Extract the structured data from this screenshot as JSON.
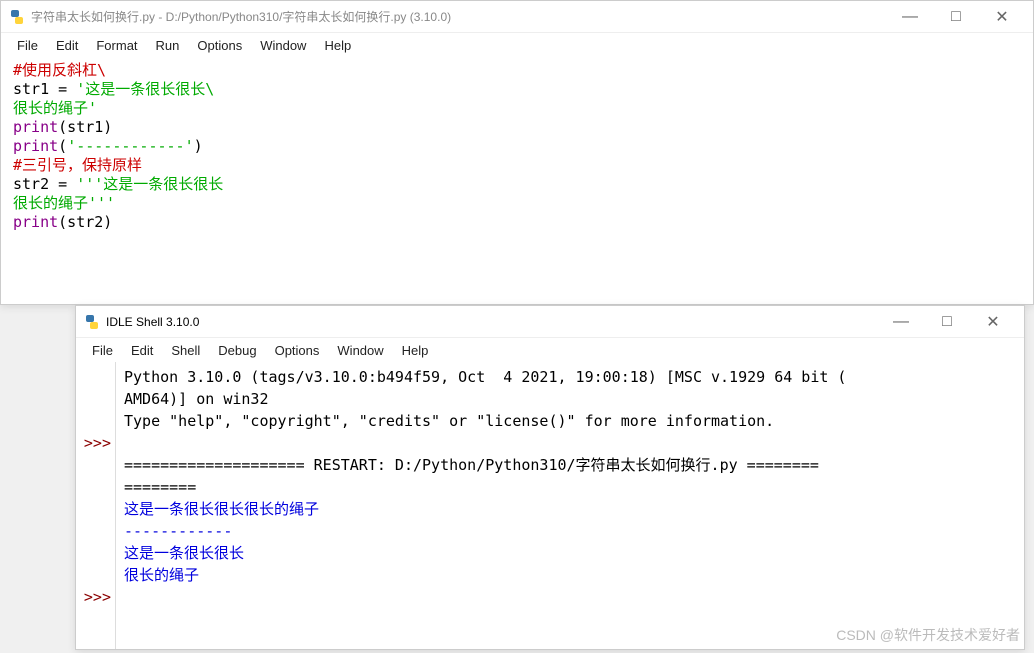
{
  "editor": {
    "title": "字符串太长如何换行.py - D:/Python/Python310/字符串太长如何换行.py (3.10.0)",
    "menu": [
      "File",
      "Edit",
      "Format",
      "Run",
      "Options",
      "Window",
      "Help"
    ],
    "code": {
      "l1_comment": "#使用反斜杠\\",
      "l2_name": "str1 ",
      "l2_op": "= ",
      "l2_str": "'这是一条很长很长\\",
      "l3_str": "很长的绳子'",
      "l4_builtin": "print",
      "l4_rest": "(str1)",
      "l5_builtin": "print",
      "l5_paren": "(",
      "l5_str": "'------------'",
      "l5_close": ")",
      "l6_comment": "#三引号，保持原样",
      "l7_name": "str2 ",
      "l7_op": "= ",
      "l7_str": "'''这是一条很长很长",
      "l8_str": "很长的绳子'''",
      "l9_builtin": "print",
      "l9_rest": "(str2)"
    }
  },
  "shell": {
    "title": "IDLE Shell 3.10.0",
    "menu": [
      "File",
      "Edit",
      "Shell",
      "Debug",
      "Options",
      "Window",
      "Help"
    ],
    "prompts": {
      "p1": ">>>",
      "p2": ">>>"
    },
    "banner_l1": "Python 3.10.0 (tags/v3.10.0:b494f59, Oct  4 2021, 19:00:18) [MSC v.1929 64 bit (",
    "banner_l2": "AMD64)] on win32",
    "banner_l3": "Type \"help\", \"copyright\", \"credits\" or \"license()\" for more information.",
    "blank": "",
    "restart_l1": "==================== RESTART: D:/Python/Python310/字符串太长如何换行.py ========",
    "restart_l2": "========",
    "out1": "这是一条很长很长很长的绳子",
    "out2": "------------",
    "out3": "这是一条很长很长",
    "out4": "很长的绳子"
  },
  "controls": {
    "min": "—",
    "max": "□",
    "close": "✕"
  },
  "watermark": "CSDN @软件开发技术爱好者"
}
